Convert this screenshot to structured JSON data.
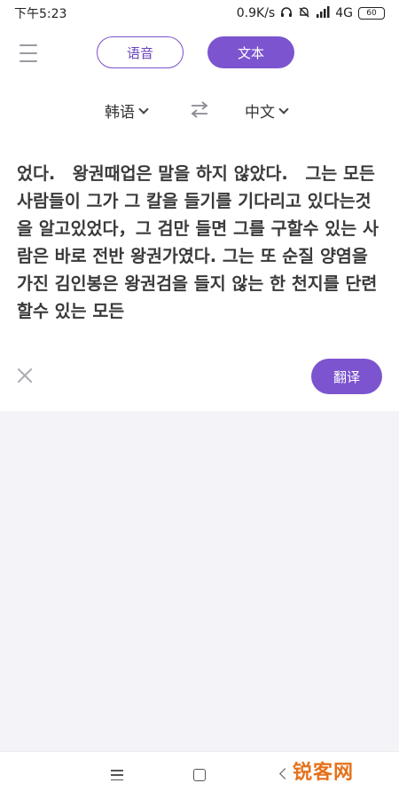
{
  "status_bar": {
    "time": "下午5:23",
    "net_speed": "0.9K/s",
    "network": "4G",
    "battery": "60"
  },
  "mode_tabs": {
    "voice_label": "语音",
    "text_label": "文本",
    "active": "text"
  },
  "languages": {
    "source": "韩语",
    "target": "中文"
  },
  "input": {
    "text": "었다.　왕권때업은 말을 하지 않았다.　그는 모든 사람들이 그가 그 칼을 들기를 기다리고 있다는것을 알고있었다，그 검만 들면 그를 구할수 있는 사람은 바로 전반 왕권가였다. 그는 또 순질 양염을 가진 김인봉은 왕권검을 들지 않는 한 천지를 단련할수 있는 모든"
  },
  "actions": {
    "translate_label": "翻译"
  },
  "watermark": "锐客网",
  "colors": {
    "accent": "#7c54cf",
    "result_bg": "#f4f4f8"
  }
}
